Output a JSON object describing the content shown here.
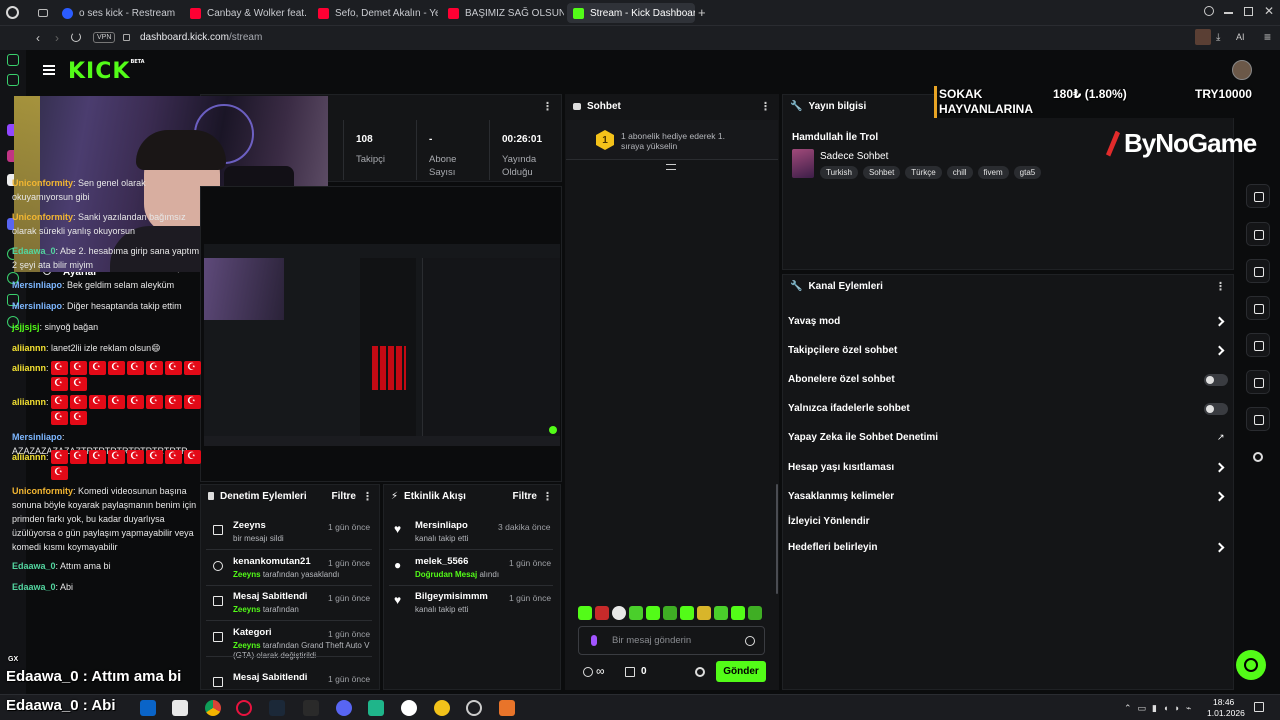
{
  "tabs": [
    {
      "label": "o ses kick - Restream",
      "color": "#2b5cff"
    },
    {
      "label": "Canbay & Wolker feat. He",
      "color": "#ff0033"
    },
    {
      "label": "Sefo, Demet Akalın - Yeni",
      "color": "#ff0033"
    },
    {
      "label": "BAŞIMIZ SAĞ OLSUN | Ma",
      "color": "#ff0033"
    },
    {
      "label": "Stream - Kick Dashboard",
      "color": "#53fc18"
    }
  ],
  "address": {
    "vpn": "VPN",
    "domain": "dashboard.kick.com",
    "path": "/stream",
    "ai": "AI"
  },
  "kick": {
    "logo": "KICK",
    "beta": "BETA"
  },
  "stats": {
    "followers_value": "108",
    "followers_label": "Takipçi",
    "subs_value": "-",
    "subs_label": "Abone Sayısı",
    "uptime_value": "00:26:01",
    "uptime_label": "Yayında Olduğu"
  },
  "settings_label": "Ayarlar",
  "chat": {
    "title": "Sohbet",
    "goal_number": "1",
    "goal_text": "1 abonelik hediye ederek 1. sıraya yükselin",
    "messages": [
      {
        "user": "Uniconformity",
        "color": "#f2b632",
        "text": "Sen genel olarak okuyamıyorsun gibi"
      },
      {
        "user": "Uniconformity",
        "color": "#f2b632",
        "text": "Sanki yazılandan bağımsız olarak sürekli yanlış okuyorsun"
      },
      {
        "user": "Edaawa_0",
        "color": "#53d6a0",
        "text": "Abe 2. hesabıma girip sana yaptım 2 şeyi ata bilir miyim"
      },
      {
        "user": "Mersinliapo",
        "color": "#7db7ff",
        "text": "Bek geldim selam aleyküm"
      },
      {
        "user": "Mersinliapo",
        "color": "#7db7ff",
        "text": "Diğer hesaptanda takip ettim"
      },
      {
        "user": "jsjjsjsj",
        "color": "#53fc18",
        "text": "sinyoğ bağan"
      },
      {
        "user": "aliiannn",
        "color": "#f2e032",
        "text": "lanet2lii izle reklam olsun😄"
      },
      {
        "user": "aliiannn",
        "color": "#f2e032",
        "text": ""
      },
      {
        "user": "aliiannn",
        "color": "#f2e032",
        "text": ""
      },
      {
        "user": "Mersinliapo",
        "color": "#7db7ff",
        "text": "AZAZAZAZAZAZTRTRTRTRTRTRTRTRTR"
      },
      {
        "user": "aliiannn",
        "color": "#f2e032",
        "text": ""
      },
      {
        "user": "Uniconformity",
        "color": "#f2b632",
        "text": "Komedi videosunun başına sonuna böyle koyarak paylaşmanın benim için primden farkı yok, bu kadar duyarlıysa üzülüyorsa o gün paylaşım yapmayabilir veya komedi kısmı koymayabilir"
      },
      {
        "user": "Edaawa_0",
        "color": "#53d6a0",
        "text": "Attım ama bi"
      },
      {
        "user": "Edaawa_0",
        "color": "#53d6a0",
        "text": "Abi"
      }
    ],
    "input_placeholder": "Bir mesaj gönderin",
    "infinity": "∞",
    "zero": "0",
    "send_label": "Gönder"
  },
  "stream_info": {
    "title": "Yayın bilgisi",
    "stream_title": "Hamdullah İle Trol",
    "category": "Sadece Sohbet",
    "tags": [
      "Turkish",
      "Sohbet",
      "Türkçe",
      "chill",
      "fivem",
      "gta5"
    ]
  },
  "donation": {
    "cause": "SOKAK HAYVANLARINA",
    "amount": "180₺ (1.80%)",
    "goal": "TRY10000",
    "sponsor": "ByNoGame"
  },
  "channel_actions": {
    "title": "Kanal Eylemleri",
    "items": [
      {
        "label": "Yavaş mod",
        "control": "chevron"
      },
      {
        "label": "Takipçilere özel sohbet",
        "control": "chevron"
      },
      {
        "label": "Abonelere özel sohbet",
        "control": "toggle"
      },
      {
        "label": "Yalnızca ifadelerle sohbet",
        "control": "toggle"
      },
      {
        "label": "Yapay Zeka ile Sohbet Denetimi",
        "control": "external"
      },
      {
        "label": "Hesap yaşı kısıtlaması",
        "control": "chevron"
      },
      {
        "label": "Yasaklanmış kelimeler",
        "control": "chevron"
      },
      {
        "label": "İzleyici Yönlendir",
        "control": "none"
      },
      {
        "label": "Hedefleri belirleyin",
        "control": "chevron"
      }
    ]
  },
  "mod_actions": {
    "title": "Denetim Eylemleri",
    "filter": "Filtre",
    "items": [
      {
        "title": "Zeeyns",
        "sub_user": "",
        "sub": "bir mesajı sildi",
        "time": "1 gün önce",
        "icon": "trash-icon"
      },
      {
        "title": "kenankomutan21",
        "sub_user": "Zeeyns",
        "sub": "tarafından yasaklandı",
        "time": "1 gün önce",
        "icon": "ban-icon"
      },
      {
        "title": "Mesaj Sabitlendi",
        "sub_user": "Zeeyns",
        "sub": "tarafından",
        "time": "1 gün önce",
        "icon": "pin-icon"
      },
      {
        "title": "Kategori",
        "sub_user": "Zeeyns",
        "sub": "tarafından Grand Theft Auto V (GTA) olarak değiştirildi",
        "time": "1 gün önce",
        "icon": "category-icon"
      },
      {
        "title": "Mesaj Sabitlendi",
        "sub_user": "",
        "sub": "",
        "time": "1 gün önce",
        "icon": "pin-icon"
      }
    ]
  },
  "activity": {
    "title": "Etkinlik Akışı",
    "filter": "Filtre",
    "items": [
      {
        "title": "Mersinliapo",
        "sub": "kanalı takip etti",
        "time": "3 dakika önce",
        "icon": "heart-icon"
      },
      {
        "title": "melek_5566",
        "sub_green": "Doğrudan Mesaj",
        "sub": "alındı",
        "time": "1 gün önce",
        "icon": "kick-icon"
      },
      {
        "title": "Bilgeymisimmm",
        "sub": "kanalı takip etti",
        "time": "1 gün önce",
        "icon": "heart-icon"
      }
    ]
  },
  "overlay": {
    "gx": "GX",
    "line1": "Edaawa_0 : Attım ama bi",
    "line2": "Edaawa_0 : Abi"
  },
  "clock": {
    "time": "18:46",
    "date": "1.01.2026"
  }
}
